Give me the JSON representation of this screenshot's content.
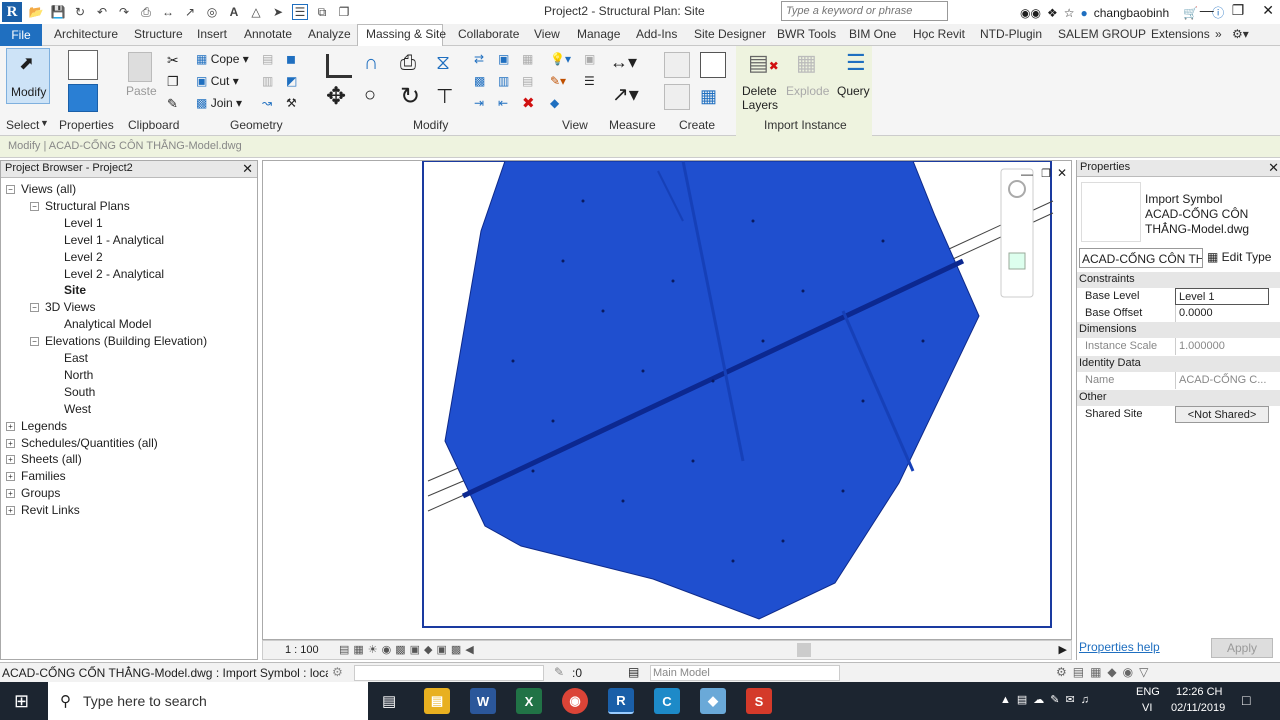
{
  "titlebar": {
    "logo": "R",
    "title": "Project2 - Structural Plan: Site",
    "search_placeholder": "Type a keyword or phrase",
    "user": "changbaobinh"
  },
  "tabs": [
    "File",
    "Architecture",
    "Structure",
    "Insert",
    "Annotate",
    "Analyze",
    "Massing & Site",
    "Collaborate",
    "View",
    "Manage",
    "Add-Ins",
    "Site Designer",
    "BWR Tools",
    "BIM One",
    "Học Revit",
    "NTD-Plugin",
    "SALEM GROUP",
    "Extensions"
  ],
  "ribbon": {
    "modify_label": "Modify",
    "paste_label": "Paste",
    "cope_label": "Cope",
    "cut_label": "Cut",
    "join_label": "Join",
    "delete_layers_label": "Delete Layers",
    "explode_label": "Explode",
    "query_label": "Query",
    "panels": [
      "Select",
      "Properties",
      "Clipboard",
      "Geometry",
      "Modify",
      "View",
      "Measure",
      "Create",
      "Import Instance"
    ],
    "properties_btn": "Properties"
  },
  "context_bar": "Modify | ACAD-CỐNG CÔN THẲNG-Model.dwg",
  "project_browser": {
    "title": "Project Browser - Project2",
    "tree": [
      {
        "label": "Views (all)",
        "level": 0
      },
      {
        "label": "Structural Plans",
        "level": 1
      },
      {
        "label": "Level 1",
        "level": 2
      },
      {
        "label": "Level 1 - Analytical",
        "level": 2
      },
      {
        "label": "Level 2",
        "level": 2
      },
      {
        "label": "Level 2 - Analytical",
        "level": 2
      },
      {
        "label": "Site",
        "level": 2
      },
      {
        "label": "3D Views",
        "level": 1
      },
      {
        "label": "Analytical Model",
        "level": 2
      },
      {
        "label": "Elevations (Building Elevation)",
        "level": 1
      },
      {
        "label": "East",
        "level": 2
      },
      {
        "label": "North",
        "level": 2
      },
      {
        "label": "South",
        "level": 2
      },
      {
        "label": "West",
        "level": 2
      },
      {
        "label": "Legends",
        "level": 0
      },
      {
        "label": "Schedules/Quantities (all)",
        "level": 0
      },
      {
        "label": "Sheets (all)",
        "level": 0
      },
      {
        "label": "Families",
        "level": 0
      },
      {
        "label": "Groups",
        "level": 0
      },
      {
        "label": "Revit Links",
        "level": 0
      }
    ]
  },
  "view": {
    "scale": "1 : 100"
  },
  "properties": {
    "title": "Properties",
    "type_line1": "Import Symbol",
    "type_line2": "ACAD-CỐNG CÔN",
    "type_line3": "THẲNG-Model.dwg",
    "type_selector": "ACAD-CỐNG CÔN TH",
    "edit_type": "Edit Type",
    "sections": {
      "constraints": "Constraints",
      "dimensions": "Dimensions",
      "identity": "Identity Data",
      "other": "Other"
    },
    "base_level_k": "Base Level",
    "base_level_v": "Level 1",
    "base_offset_k": "Base Offset",
    "base_offset_v": "0.0000",
    "instance_scale_k": "Instance Scale",
    "instance_scale_v": "1.000000",
    "name_k": "Name",
    "name_v": "ACAD-CỐNG C...",
    "shared_site_k": "Shared Site",
    "shared_site_v": "<Not Shared>",
    "help_link": "Properties help",
    "apply": "Apply"
  },
  "status": {
    "text": "ACAD-CỐNG CỐN THẲNG-Model.dwg : Import Symbol : location",
    "count": ":0",
    "model": "Main Model"
  },
  "taskbar": {
    "search": "Type here to search",
    "lang1": "ENG",
    "lang2": "VI",
    "time": "12:26 CH",
    "date": "02/11/2019"
  },
  "colors": {
    "accent": "#1f6fc0",
    "drawing": "#1f4fcf",
    "ribbon_context": "#eef3df"
  }
}
